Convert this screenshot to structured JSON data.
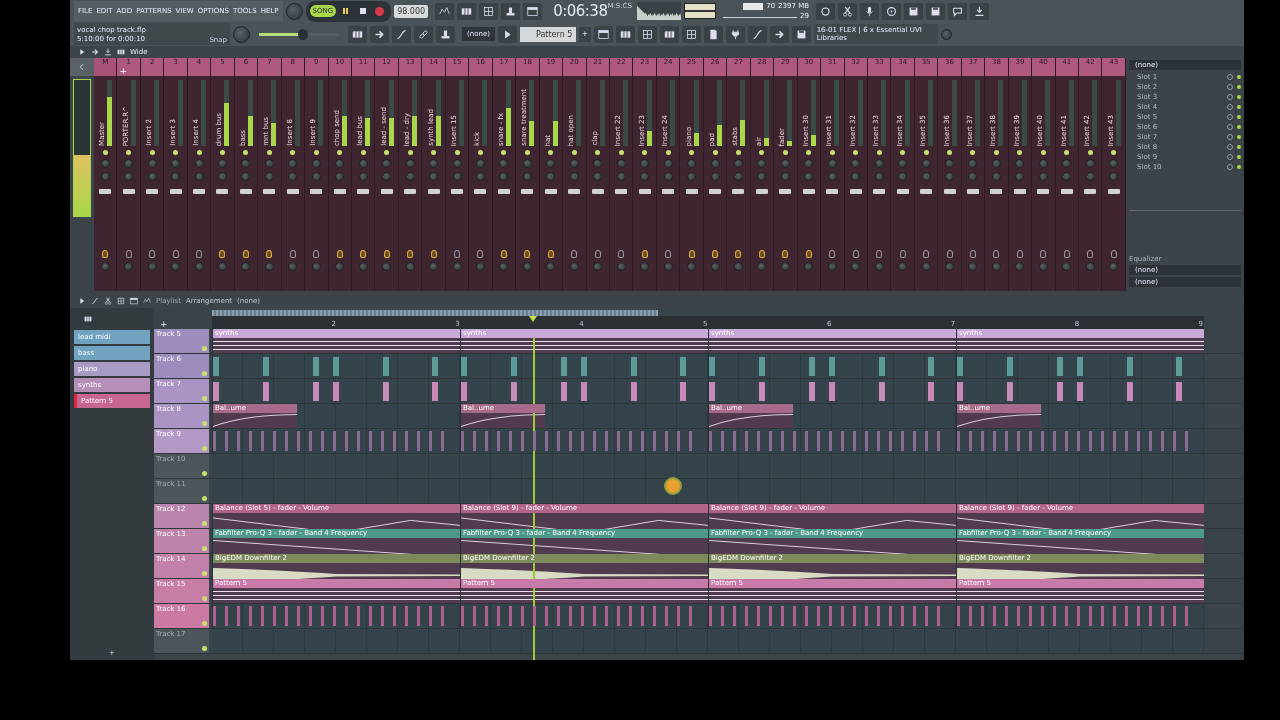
{
  "toolbar": {
    "menu": [
      "FILE",
      "EDIT",
      "ADD",
      "PATTERNS",
      "VIEW",
      "OPTIONS",
      "TOOLS",
      "HELP"
    ],
    "hint": {
      "file": "vocal chop track.flp",
      "range": "5:10:00 for 0:00:10",
      "snap": "Snap"
    },
    "mode": {
      "label": "SONG",
      "selected": true
    },
    "tempo": "98.000",
    "time": "0:06:38",
    "time_format": "M:S:CS",
    "master_volume": {
      "level": 0.55
    },
    "memory": {
      "cpu": "70",
      "ram": "2397 MB",
      "polyphony": "29"
    },
    "preset": "(none)",
    "pattern": "Pattern 5",
    "add": "+",
    "plugin_hint": "16-01 FLEX | 6 x Essential UVI Libraries",
    "view": "Wide"
  },
  "mixer": {
    "add": "+",
    "master_meter": {
      "level": 0.45
    },
    "strips": [
      {
        "number": "M",
        "name": "Master",
        "level": 0.75
      },
      {
        "number": "1",
        "name": "PORTER.R^",
        "level": 0
      },
      {
        "number": "2",
        "name": "Insert 2",
        "level": 0
      },
      {
        "number": "3",
        "name": "Insert 3",
        "level": 0
      },
      {
        "number": "4",
        "name": "Insert 4",
        "level": 0
      },
      {
        "number": "5",
        "name": "drum bus",
        "level": 0.65
      },
      {
        "number": "6",
        "name": "bass",
        "level": 0.45
      },
      {
        "number": "7",
        "name": "mnt bus",
        "level": 0.35
      },
      {
        "number": "8",
        "name": "Insert 8",
        "level": 0
      },
      {
        "number": "9",
        "name": "Insert 9",
        "level": 0
      },
      {
        "number": "10",
        "name": "chop send",
        "level": 0.45
      },
      {
        "number": "11",
        "name": "lead bus",
        "level": 0.42
      },
      {
        "number": "12",
        "name": "lead - send",
        "level": 0.42
      },
      {
        "number": "13",
        "name": "lead - dry",
        "level": 0.45
      },
      {
        "number": "14",
        "name": "synth lead",
        "level": 0.45
      },
      {
        "number": "15",
        "name": "Insert 15",
        "level": 0
      },
      {
        "number": "16",
        "name": "kick",
        "level": 0
      },
      {
        "number": "17",
        "name": "snare - fx",
        "level": 0.58
      },
      {
        "number": "18",
        "name": "snare treatment",
        "level": 0.38
      },
      {
        "number": "19",
        "name": "hat",
        "level": 0.38
      },
      {
        "number": "20",
        "name": "hat open",
        "level": 0
      },
      {
        "number": "21",
        "name": "clap",
        "level": 0
      },
      {
        "number": "22",
        "name": "Insert 22",
        "level": 0
      },
      {
        "number": "23",
        "name": "Insert 23",
        "level": 0.22
      },
      {
        "number": "24",
        "name": "Insert 24",
        "level": 0
      },
      {
        "number": "25",
        "name": "piano",
        "level": 0.2
      },
      {
        "number": "26",
        "name": "pad",
        "level": 0.32
      },
      {
        "number": "27",
        "name": "stabs",
        "level": 0.4
      },
      {
        "number": "28",
        "name": "air",
        "level": 0.12
      },
      {
        "number": "29",
        "name": "fader",
        "level": 0.08
      },
      {
        "number": "30",
        "name": "Insert 30",
        "level": 0.16
      },
      {
        "number": "31",
        "name": "Insert 31",
        "level": 0
      },
      {
        "number": "32",
        "name": "Insert 32",
        "level": 0
      },
      {
        "number": "33",
        "name": "Insert 33",
        "level": 0
      },
      {
        "number": "34",
        "name": "Insert 34",
        "level": 0
      },
      {
        "number": "35",
        "name": "Insert 35",
        "level": 0
      },
      {
        "number": "36",
        "name": "Insert 36",
        "level": 0
      },
      {
        "number": "37",
        "name": "Insert 37",
        "level": 0
      },
      {
        "number": "38",
        "name": "Insert 38",
        "level": 0
      },
      {
        "number": "39",
        "name": "Insert 39",
        "level": 0
      },
      {
        "number": "40",
        "name": "Insert 40",
        "level": 0
      },
      {
        "number": "41",
        "name": "Insert 41",
        "level": 0
      },
      {
        "number": "42",
        "name": "Insert 42",
        "level": 0
      },
      {
        "number": "43",
        "name": "Insert 43",
        "level": 0
      }
    ],
    "panel": {
      "preset": "(none)",
      "slots": [
        "Slot 1",
        "Slot 2",
        "Slot 3",
        "Slot 4",
        "Slot 5",
        "Slot 6",
        "Slot 7",
        "Slot 8",
        "Slot 9",
        "Slot 10"
      ],
      "equalizer": "Equalizer",
      "outputs": [
        "(none)",
        "(none)"
      ]
    }
  },
  "playlist": {
    "title": "Playlist",
    "arrangement": "Arrangement",
    "selection": "(none)",
    "add": "+",
    "song_position": {
      "level": 0.324
    },
    "ruler": [
      "2",
      "3",
      "4",
      "5",
      "6",
      "7",
      "8",
      "9"
    ],
    "patterns": [
      {
        "label": "lead midi",
        "color": "#6fa3c0",
        "selected": false
      },
      {
        "label": "bass",
        "color": "#6fa3c0",
        "selected": false
      },
      {
        "label": "piano",
        "color": "#a89cc4",
        "selected": false
      },
      {
        "label": "synths",
        "color": "#b68fb8",
        "selected": false
      },
      {
        "label": "Pattern 5",
        "color": "#c7678f",
        "selected": true
      }
    ],
    "picker_add": "+",
    "tracks": [
      {
        "name": "Track 5",
        "kind": "pattern",
        "color": "#9c8dbd",
        "clip_style": {
          "color": "#c8a8d6"
        },
        "clips": [
          "synths",
          "synths",
          "synths",
          "synths"
        ]
      },
      {
        "name": "Track 6",
        "kind": "hits",
        "color": "#9c8dbd",
        "clip_style": {
          "color": "#5e9a9a"
        }
      },
      {
        "name": "Track 7",
        "kind": "hits",
        "color": "#a994c4",
        "clip_style": {
          "color": "#c88ab8"
        }
      },
      {
        "name": "Track 8",
        "kind": "short",
        "color": "#a994c4",
        "clip_style": {
          "color": "#a66a8a"
        },
        "clips": [
          "Bal..ume",
          "Bal..ume",
          "Bal..ume",
          "Bal..ume"
        ]
      },
      {
        "name": "Track 9",
        "kind": "dense",
        "color": "#b39ac6",
        "clip_style": {
          "color": "#8a6a8e"
        }
      },
      {
        "name": "Track 10",
        "kind": "empty",
        "color": "#4c555a"
      },
      {
        "name": "Track 11",
        "kind": "empty",
        "color": "#4c555a"
      },
      {
        "name": "Track 12",
        "kind": "automation",
        "color": "#b985ad",
        "clip_style": {
          "color": "#b06488"
        },
        "clips": [
          "Balance (Slot 5) - fader - Volume",
          "Balance (Slot 9) - fader - Volume",
          "Balance (Slot 9) - fader - Volume",
          "Balance (Slot 9) - fader - Volume"
        ]
      },
      {
        "name": "Track 13",
        "kind": "automation",
        "color": "#bd84aa",
        "clip_style": {
          "color": "#4e9a8a"
        },
        "clips": [
          "Fabfilter Pro-Q 3 - fader - Band 4 Frequency",
          "Fabfilter Pro-Q 3 - fader - Band 4 Frequency",
          "Fabfilter Pro-Q 3 - fader - Band 4 Frequency",
          "Fabfilter Pro-Q 3 - fader - Band 4 Frequency"
        ]
      },
      {
        "name": "Track 14",
        "kind": "audio",
        "color": "#c281a8",
        "clip_style": {
          "color": "#7d8a5e"
        },
        "clips": [
          "BigEDM Downfilter 2",
          "BigEDM Downfilter 2",
          "BigEDM Downfilter 2",
          "BigEDM Downfilter 2"
        ]
      },
      {
        "name": "Track 15",
        "kind": "pattern",
        "color": "#c77ea6",
        "clip_style": {
          "color": "#c87aa8"
        },
        "clips": [
          "Pattern 5",
          "Pattern 5",
          "Pattern 5",
          "Pattern 5"
        ]
      },
      {
        "name": "Track 16",
        "kind": "dense",
        "color": "#cc7aa4",
        "clip_style": {
          "color": "#b0608e"
        }
      },
      {
        "name": "Track 17",
        "kind": "empty",
        "color": "#4c555a"
      }
    ]
  }
}
